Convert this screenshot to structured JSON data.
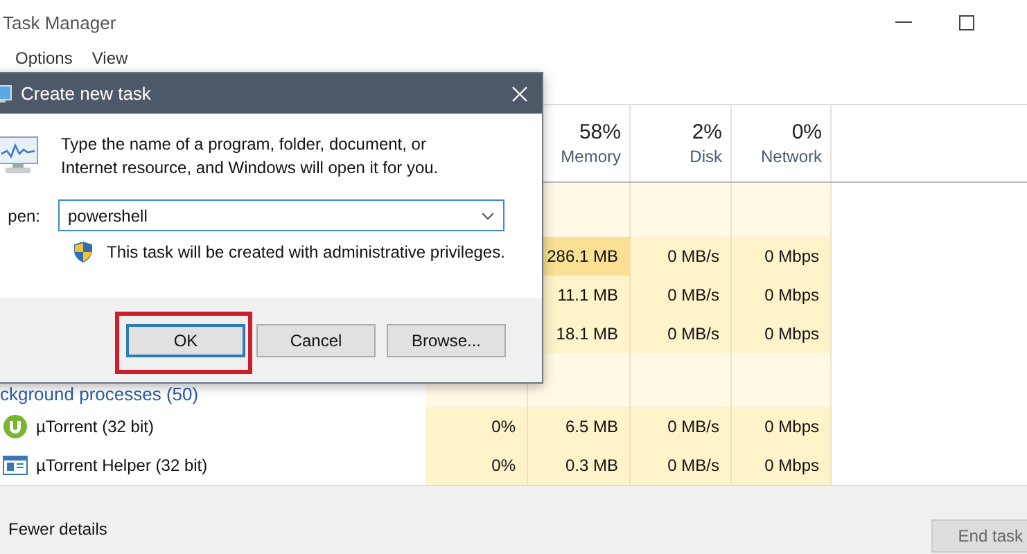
{
  "window": {
    "title": "Task Manager"
  },
  "menu": [
    {
      "label": "Options"
    },
    {
      "label": "View"
    }
  ],
  "table": {
    "columns": [
      {
        "percent": "58%",
        "label": "Memory"
      },
      {
        "percent": "2%",
        "label": "Disk"
      },
      {
        "percent": "0%",
        "label": "Network"
      }
    ],
    "rows": [
      {
        "kind": "group"
      },
      {
        "kind": "process",
        "memory": "286.1 MB",
        "memory_highlighted": true,
        "disk": "0 MB/s",
        "network": "0 Mbps"
      },
      {
        "kind": "process",
        "memory": "11.1 MB",
        "memory_highlighted": false,
        "disk": "0 MB/s",
        "network": "0 Mbps"
      },
      {
        "kind": "process",
        "memory": "18.1 MB",
        "memory_highlighted": false,
        "disk": "0 MB/s",
        "network": "0 Mbps"
      },
      {
        "kind": "group",
        "label": "ckground processes (50)"
      },
      {
        "kind": "process",
        "name": "µTorrent (32 bit)",
        "cpu": "0%",
        "memory": "6.5 MB",
        "memory_highlighted": false,
        "disk": "0 MB/s",
        "network": "0 Mbps"
      },
      {
        "kind": "process",
        "name": "µTorrent Helper (32 bit)",
        "cpu": "0%",
        "memory": "0.3 MB",
        "memory_highlighted": false,
        "disk": "0 MB/s",
        "network": "0 Mbps"
      }
    ]
  },
  "footer": {
    "details_link": "Fewer details",
    "end_task": "End task"
  },
  "dialog": {
    "title": "Create new task",
    "description": "Type the name of a program, folder, document, or Internet resource, and Windows will open it for you.",
    "open_label": "pen:",
    "open_value": "powershell",
    "note": "This task will be created with administrative privileges.",
    "buttons": [
      {
        "label": "OK",
        "selected": true,
        "highlighted": true
      },
      {
        "label": "Cancel",
        "selected": false,
        "highlighted": false
      },
      {
        "label": "Browse...",
        "selected": false,
        "highlighted": false
      }
    ]
  }
}
